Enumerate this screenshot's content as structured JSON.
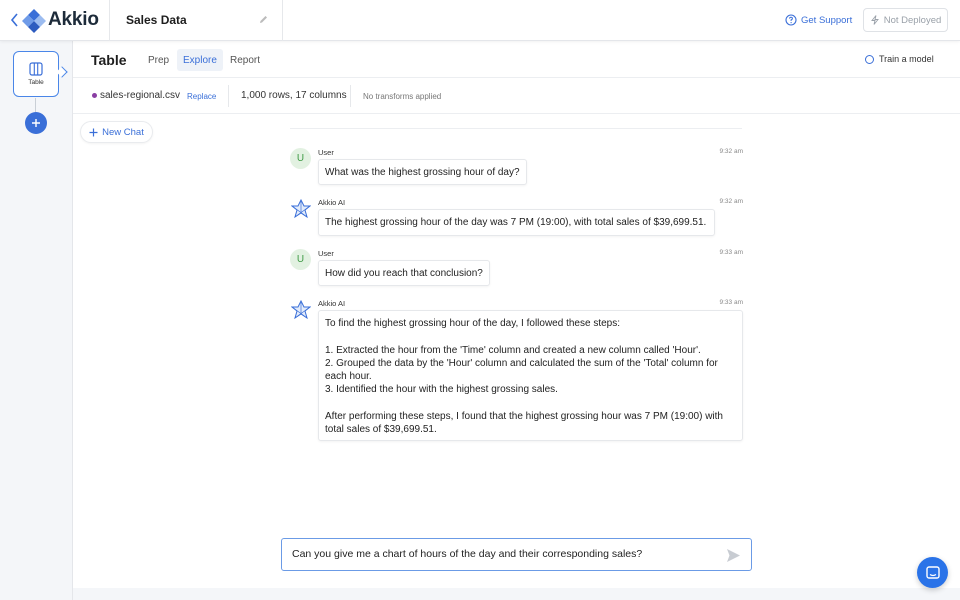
{
  "header": {
    "logo_text": "Akkio",
    "title": "Sales Data",
    "support_label": "Get Support",
    "deploy_label": "Not Deployed"
  },
  "rail": {
    "card_label": "Table"
  },
  "subheader": {
    "title": "Table",
    "tabs": [
      {
        "label": "Prep"
      },
      {
        "label": "Explore"
      },
      {
        "label": "Report"
      }
    ],
    "active_tab": "Explore",
    "train_label": "Train a model"
  },
  "dataset": {
    "filename": "sales-regional.csv",
    "replace_label": "Replace",
    "rows_info": "1,000 rows, 17 columns",
    "transforms": "No transforms applied"
  },
  "chat": {
    "new_chat_label": "New Chat",
    "messages": [
      {
        "avatar": "U",
        "sender": "User",
        "time": "9:32 am",
        "text": "What was the highest grossing hour of day?"
      },
      {
        "avatar": "ai-icon",
        "sender": "Akkio AI",
        "time": "9:32 am",
        "text": "The highest grossing hour of the day was 7 PM (19:00), with total sales of $39,699.51."
      },
      {
        "avatar": "U",
        "sender": "User",
        "time": "9:33 am",
        "text": "How did you reach that conclusion?"
      },
      {
        "avatar": "ai-icon",
        "sender": "Akkio AI",
        "time": "9:33 am",
        "text": "To find the highest grossing hour of the day, I followed these steps:\n\n1. Extracted the hour from the 'Time' column and created a new column called 'Hour'.\n2. Grouped the data by the 'Hour' column and calculated the sum of the 'Total' column for each hour.\n3. Identified the hour with the highest grossing sales.\n\nAfter performing these steps, I found that the highest grossing hour was 7 PM (19:00) with total sales of $39,699.51."
      }
    ],
    "input_value": "Can you give me a chart of hours of the day and their corresponding sales?"
  },
  "colors": {
    "accent": "#3a6fd8",
    "user_avatar_bg": "#e2f1e1",
    "file_dot": "#8a3ea3"
  }
}
